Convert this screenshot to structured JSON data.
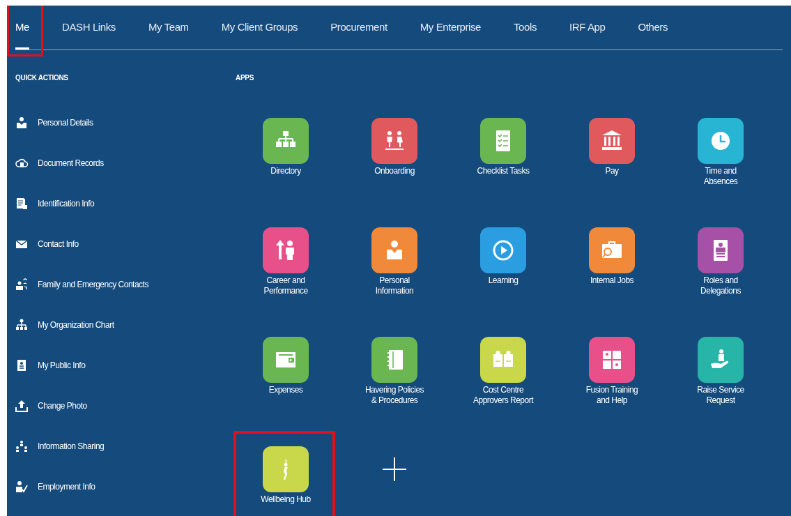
{
  "tabs": [
    {
      "label": "Me",
      "selected": true,
      "highlighted": true
    },
    {
      "label": "DASH Links",
      "selected": false,
      "highlighted": false
    },
    {
      "label": "My Team",
      "selected": false,
      "highlighted": false
    },
    {
      "label": "My Client Groups",
      "selected": false,
      "highlighted": false
    },
    {
      "label": "Procurement",
      "selected": false,
      "highlighted": false
    },
    {
      "label": "My Enterprise",
      "selected": false,
      "highlighted": false
    },
    {
      "label": "Tools",
      "selected": false,
      "highlighted": false
    },
    {
      "label": "IRF App",
      "selected": false,
      "highlighted": false
    },
    {
      "label": "Others",
      "selected": false,
      "highlighted": false
    }
  ],
  "quick_actions": {
    "title": "QUICK ACTIONS",
    "items": [
      {
        "label": "Personal Details"
      },
      {
        "label": "Document Records"
      },
      {
        "label": "Identification Info"
      },
      {
        "label": "Contact Info"
      },
      {
        "label": "Family and Emergency Contacts"
      },
      {
        "label": "My Organization Chart"
      },
      {
        "label": "My Public Info"
      },
      {
        "label": "Change Photo"
      },
      {
        "label": "Information Sharing"
      },
      {
        "label": "Employment Info"
      }
    ]
  },
  "apps": {
    "title": "APPS",
    "items": [
      {
        "label": "Directory",
        "color": "#6ab651",
        "highlighted": false
      },
      {
        "label": "Onboarding",
        "color": "#e05a5d",
        "highlighted": false
      },
      {
        "label": "Checklist Tasks",
        "color": "#6ab651",
        "highlighted": false
      },
      {
        "label": "Pay",
        "color": "#e05a5d",
        "highlighted": false
      },
      {
        "label": "Time and\nAbsences",
        "color": "#27b5d3",
        "highlighted": false
      },
      {
        "label": "Career and\nPerformance",
        "color": "#e8508a",
        "highlighted": false
      },
      {
        "label": "Personal\nInformation",
        "color": "#f0893a",
        "highlighted": false
      },
      {
        "label": "Learning",
        "color": "#2a9ee0",
        "highlighted": false
      },
      {
        "label": "Internal Jobs",
        "color": "#f0893a",
        "highlighted": false
      },
      {
        "label": "Roles and\nDelegations",
        "color": "#a650a8",
        "highlighted": false
      },
      {
        "label": "Expenses",
        "color": "#6ab651",
        "highlighted": false
      },
      {
        "label": "Havering Policies\n& Procedures",
        "color": "#6ab651",
        "highlighted": false
      },
      {
        "label": "Cost Centre\nApprovers Report",
        "color": "#c8d84a",
        "highlighted": false
      },
      {
        "label": "Fusion Training\nand Help",
        "color": "#e8508a",
        "highlighted": false
      },
      {
        "label": "Raise Service\nRequest",
        "color": "#27b5a8",
        "highlighted": false
      },
      {
        "label": "Wellbeing Hub",
        "color": "#c8d84a",
        "highlighted": true
      }
    ]
  }
}
